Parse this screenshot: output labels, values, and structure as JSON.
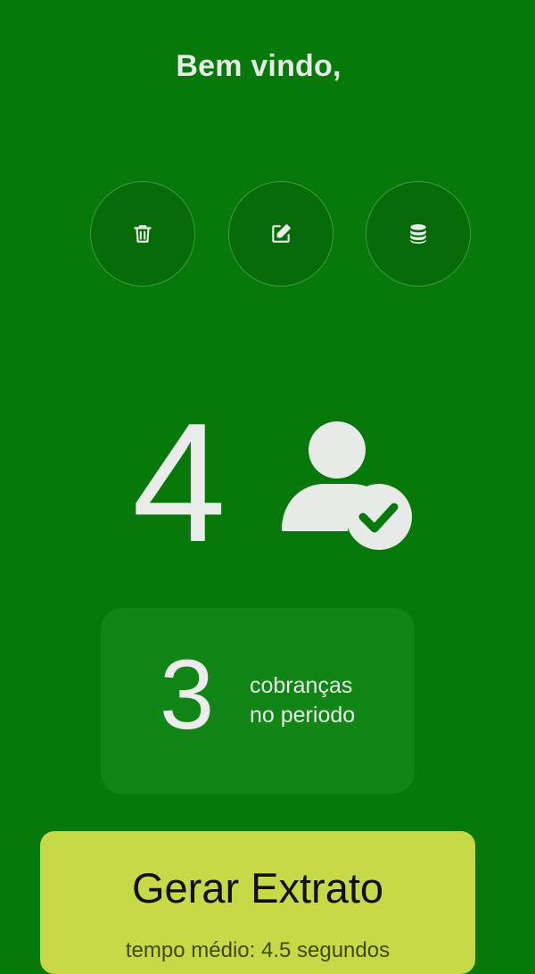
{
  "header": {
    "greeting": "Bem vindo,"
  },
  "actions": [
    {
      "icon": "trash-icon"
    },
    {
      "icon": "edit-icon"
    },
    {
      "icon": "database-icon"
    }
  ],
  "stats": {
    "users_count": "4",
    "users_icon": "user-check-icon"
  },
  "period_card": {
    "count": "3",
    "label_line1": "cobranças",
    "label_line2": "no periodo"
  },
  "extract_button": {
    "label": "Gerar Extrato",
    "subtitle": "tempo médio: 4.5 segundos"
  },
  "colors": {
    "background": "#07790a",
    "button_circle": "#066b08",
    "card": "#118515",
    "extract_button": "#c8d948"
  }
}
